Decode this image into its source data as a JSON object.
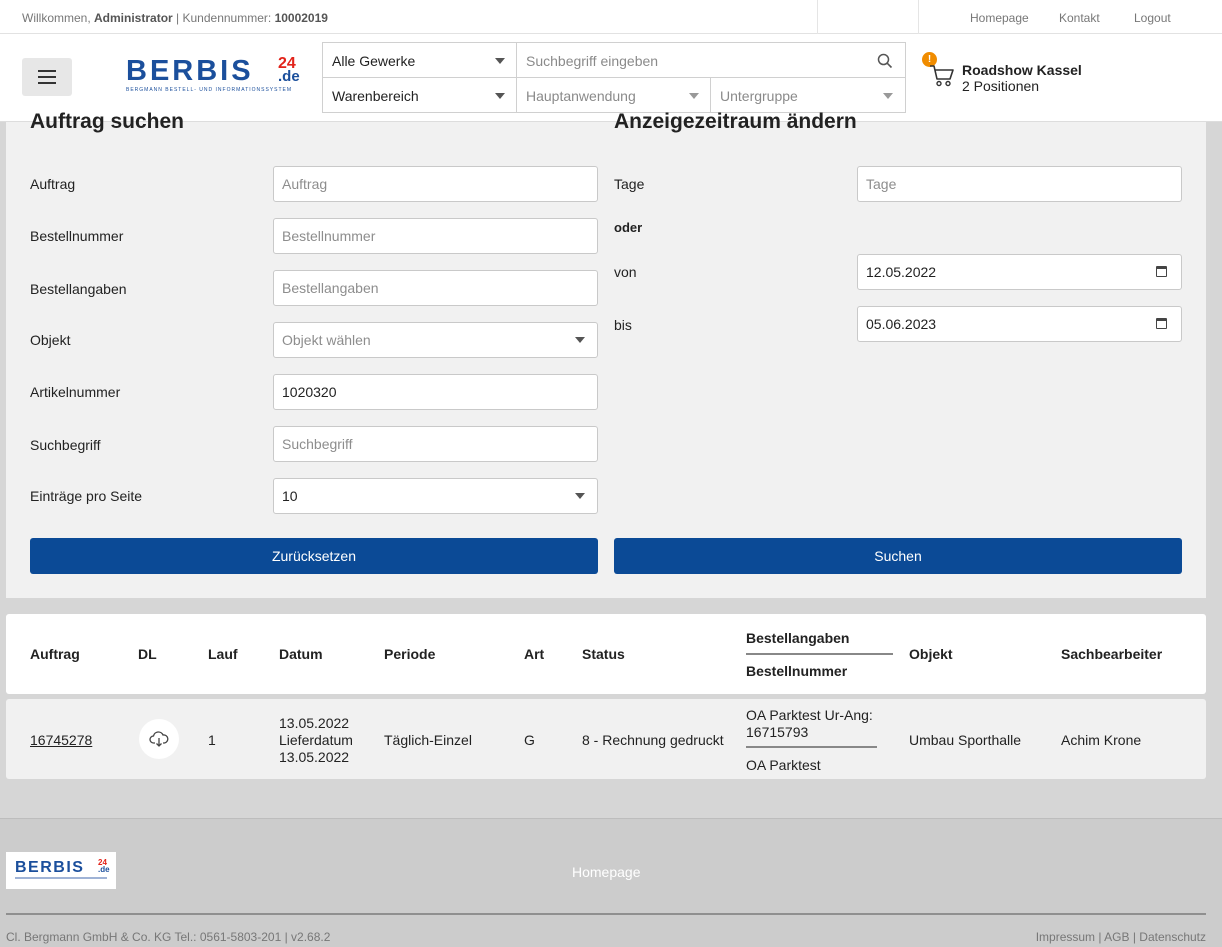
{
  "topbar": {
    "welcome_prefix": "Willkommen,",
    "user": "Administrator",
    "customer_label": "| Kundennummer:",
    "customer_number": "10002019",
    "links": [
      "Homepage",
      "Kontakt",
      "Logout"
    ]
  },
  "header": {
    "logo_text": "BERBIS",
    "logo_num": "24",
    "logo_tld": ".de",
    "logo_tagline": "BERGMANN BESTELL- UND INFORMATIONSSYSTEM",
    "search": {
      "trade_select": "Alle Gewerke",
      "search_placeholder": "Suchbegriff eingeben",
      "category_select": "Warenbereich",
      "application_select": "Hauptanwendung",
      "subgroup_select": "Untergruppe"
    },
    "cart": {
      "badge": "!",
      "title": "Roadshow Kassel",
      "positions": "2 Positionen"
    }
  },
  "search_form": {
    "title": "Auftrag suchen",
    "fields": {
      "auftrag": {
        "label": "Auftrag",
        "placeholder": "Auftrag"
      },
      "bestellnummer": {
        "label": "Bestellnummer",
        "placeholder": "Bestellnummer"
      },
      "bestellangaben": {
        "label": "Bestellangaben",
        "placeholder": "Bestellangaben"
      },
      "objekt": {
        "label": "Objekt",
        "placeholder": "Objekt wählen"
      },
      "artikelnummer": {
        "label": "Artikelnummer",
        "value": "1020320"
      },
      "suchbegriff": {
        "label": "Suchbegriff",
        "placeholder": "Suchbegriff"
      },
      "eintraege": {
        "label": "Einträge pro Seite",
        "value": "10"
      }
    },
    "reset_button": "Zurücksetzen"
  },
  "period_form": {
    "title": "Anzeigezeitraum ändern",
    "tage": {
      "label": "Tage",
      "placeholder": "Tage"
    },
    "oder": "oder",
    "von": {
      "label": "von",
      "value": "12.05.2022"
    },
    "bis": {
      "label": "bis",
      "value": "05.06.2023"
    },
    "search_button": "Suchen"
  },
  "table": {
    "headers": {
      "auftrag": "Auftrag",
      "dl": "DL",
      "lauf": "Lauf",
      "datum": "Datum",
      "periode": "Periode",
      "art": "Art",
      "status": "Status",
      "bestellangaben": "Bestellangaben",
      "bestellnummer": "Bestellnummer",
      "objekt": "Objekt",
      "sachbearbeiter": "Sachbearbeiter"
    },
    "rows": [
      {
        "auftrag": "16745278",
        "lauf": "1",
        "datum": "13.05.2022",
        "lieferdatum_label": "Lieferdatum",
        "lieferdatum": "13.05.2022",
        "periode": "Täglich-Einzel",
        "art": "G",
        "status": "8 - Rechnung gedruckt",
        "bestellangaben_1": "OA Parktest Ur-Ang:",
        "bestellangaben_2": "16715793",
        "bestellnummer": "OA Parktest",
        "objekt": "Umbau Sporthalle",
        "sachbearbeiter": "Achim Krone"
      }
    ]
  },
  "footer": {
    "logo_text": "BERBIS",
    "logo_num": "24",
    "logo_tld": ".de",
    "homepage": "Homepage",
    "copyright": "Cl. Bergmann GmbH & Co. KG Tel.: 0561-5803-201 | v2.68.2",
    "legal_links": "Impressum | AGB | Datenschutz"
  }
}
